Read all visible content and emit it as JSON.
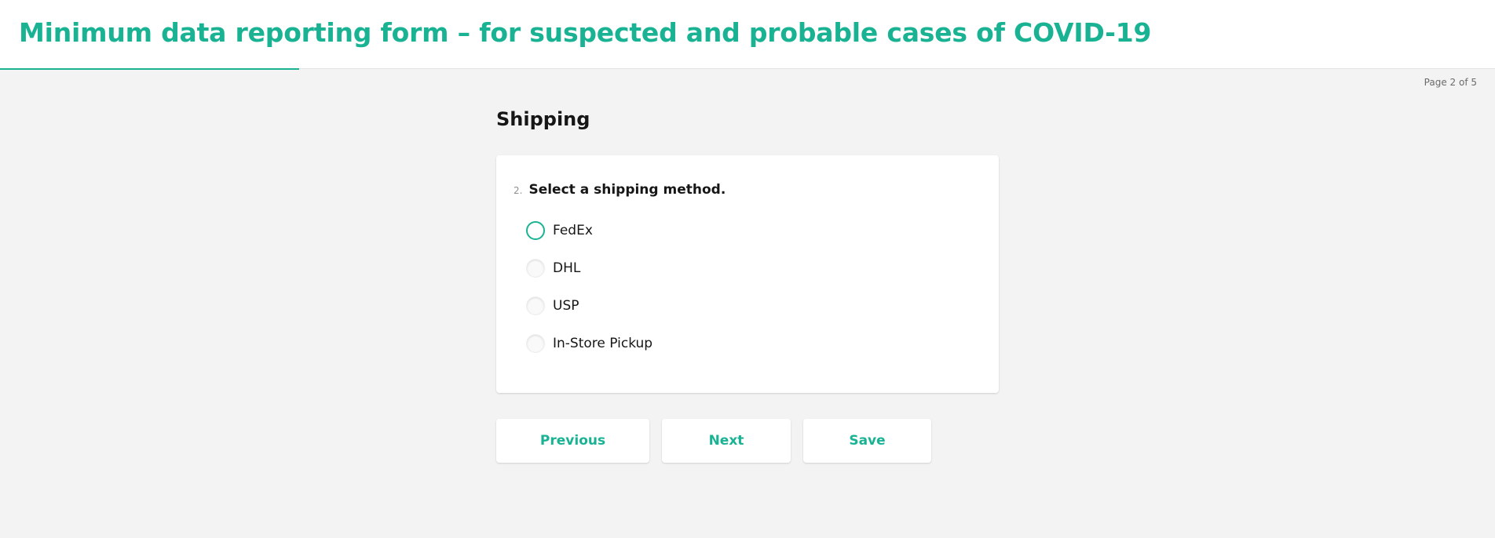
{
  "survey": {
    "title": "Minimum data reporting form – for suspected and probable cases of COVID-19",
    "progress_fraction": 0.2
  },
  "page_counter": "Page 2 of 5",
  "page": {
    "title": "Shipping",
    "question": {
      "number": "2.",
      "text": "Select a shipping method.",
      "choices": [
        "FedEx",
        "DHL",
        "USP",
        "In-Store Pickup"
      ]
    }
  },
  "navigation": {
    "previous_label": "Previous",
    "next_label": "Next",
    "save_label": "Save"
  },
  "colors": {
    "accent": "#19b394",
    "background": "#f3f3f3"
  }
}
